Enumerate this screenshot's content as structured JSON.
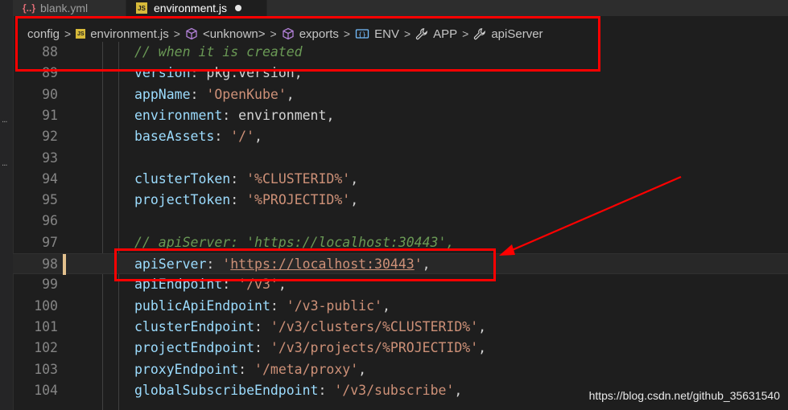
{
  "tabs": [
    {
      "label": "blank.yml",
      "icon": "yaml-braces-icon",
      "active": false
    },
    {
      "label": "environment.js",
      "icon": "js-file-icon",
      "active": true,
      "dirty": true
    }
  ],
  "breadcrumb": {
    "items": [
      "config",
      "environment.js",
      "<unknown>",
      "exports",
      "ENV",
      "APP",
      "apiServer"
    ]
  },
  "code": {
    "lines": [
      {
        "n": "88",
        "comment": "// when it is created"
      },
      {
        "n": "89",
        "key": "version",
        "plain": "pkg.version",
        "tail": ","
      },
      {
        "n": "90",
        "key": "appName",
        "str": "'OpenKube'",
        "tail": ","
      },
      {
        "n": "91",
        "key": "environment",
        "plain": "environment",
        "tail": ","
      },
      {
        "n": "92",
        "key": "baseAssets",
        "str": "'/'",
        "tail": ","
      },
      {
        "n": "93"
      },
      {
        "n": "94",
        "key": "clusterToken",
        "str": "'%CLUSTERID%'",
        "tail": ","
      },
      {
        "n": "95",
        "key": "projectToken",
        "str": "'%PROJECTID%'",
        "tail": ","
      },
      {
        "n": "96"
      },
      {
        "n": "97",
        "comment": "// apiServer: 'https://localhost:30443',"
      },
      {
        "n": "98",
        "key": "apiServer",
        "str": "'https://localhost:30443'",
        "tail": ","
      },
      {
        "n": "99",
        "key": "apiEndpoint",
        "str": "'/v3'",
        "tail": ","
      },
      {
        "n": "100",
        "key": "publicApiEndpoint",
        "str": "'/v3-public'",
        "tail": ","
      },
      {
        "n": "101",
        "key": "clusterEndpoint",
        "str": "'/v3/clusters/%CLUSTERID%'",
        "tail": ","
      },
      {
        "n": "102",
        "key": "projectEndpoint",
        "str": "'/v3/projects/%PROJECTID%'",
        "tail": ","
      },
      {
        "n": "103",
        "key": "proxyEndpoint",
        "str": "'/meta/proxy'",
        "tail": ","
      },
      {
        "n": "104",
        "key": "globalSubscribeEndpoint",
        "str": "'/v3/subscribe'",
        "tail": ","
      }
    ],
    "current_line": "98"
  },
  "watermark": "https://blog.csdn.net/github_35631540",
  "colors": {
    "annotation": "#ff0000",
    "string": "#ce9178",
    "property": "#9cdcfe",
    "comment": "#6a9955"
  }
}
